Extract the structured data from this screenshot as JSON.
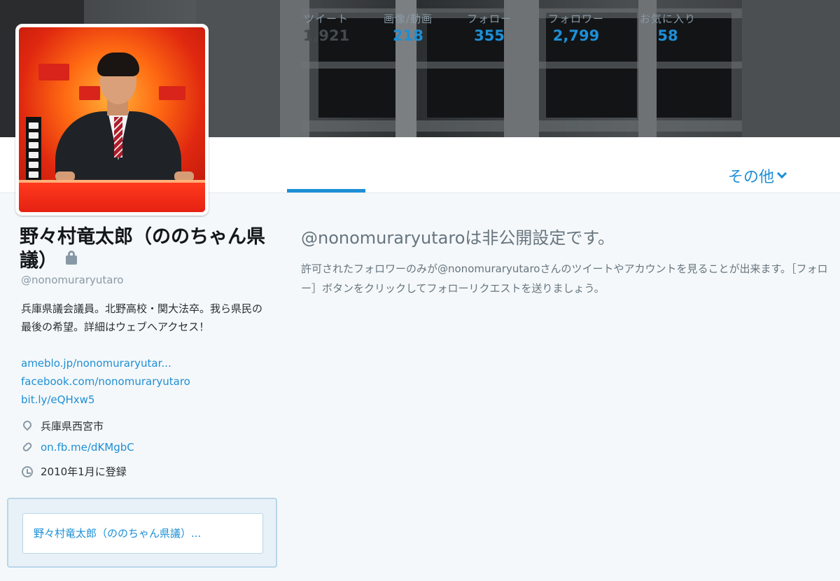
{
  "nav": {
    "items": [
      {
        "label": "ツイート",
        "count": "1,921"
      },
      {
        "label": "画像/動画",
        "count": "218"
      },
      {
        "label": "フォロー",
        "count": "355"
      },
      {
        "label": "フォロワー",
        "count": "2,799"
      },
      {
        "label": "お気に入り",
        "count": "58"
      }
    ],
    "more_label": "その他"
  },
  "profile": {
    "name": "野々村竜太郎（ののちゃん県議）",
    "handle": "@nonomuraryutaro",
    "bio": "兵庫県議会議員。北野高校・関大法卒。我ら県民の最後の希望。詳細はウェブへアクセス！",
    "links": [
      "ameblo.jp/nonomuraryutar...",
      "facebook.com/nonomuraryutaro",
      "bit.ly/eQHxw5"
    ],
    "location": "兵庫県西宮市",
    "website": "on.fb.me/dKMgbC",
    "joined": "2010年1月に登録",
    "card_title": "野々村竜太郎（ののちゃん県議）..."
  },
  "protected": {
    "title": "@nonomuraryutaroは非公開設定です。",
    "description": "許可されたフォロワーのみが@nonomuraryutaroさんのツイートやアカウントを見ることが出来ます。［フォロー］ボタンをクリックしてフォローリクエストを送りましょう。"
  },
  "colors": {
    "accent": "#1d8fd6",
    "background": "#f5f8fa"
  },
  "icons": [
    "lock-icon",
    "location-pin-icon",
    "link-icon",
    "calendar-clock-icon",
    "chevron-down-icon"
  ]
}
